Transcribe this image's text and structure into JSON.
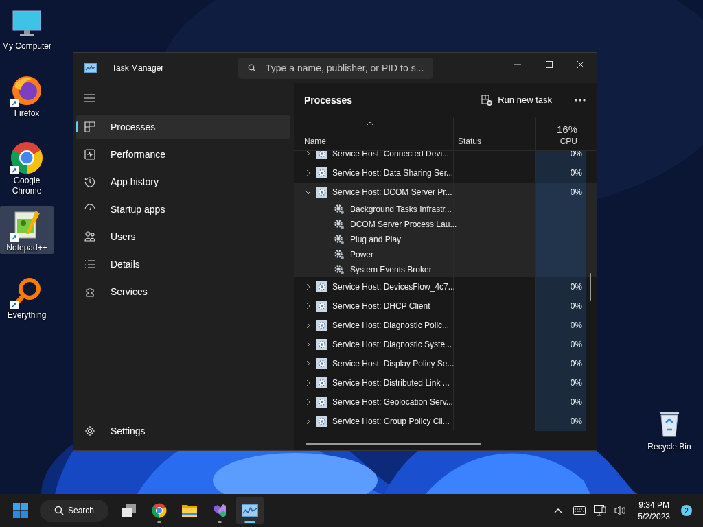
{
  "desktop": {
    "icons": [
      {
        "label": "My Computer",
        "kind": "computer",
        "shortcut": false,
        "selected": false
      },
      {
        "label": "Firefox",
        "kind": "firefox",
        "shortcut": true,
        "selected": false
      },
      {
        "label": "Google Chrome",
        "kind": "chrome",
        "shortcut": true,
        "selected": false
      },
      {
        "label": "Notepad++",
        "kind": "notepad",
        "shortcut": true,
        "selected": true
      },
      {
        "label": "Everything",
        "kind": "everything",
        "shortcut": true,
        "selected": false
      }
    ],
    "recycle_bin": {
      "label": "Recycle Bin"
    }
  },
  "window": {
    "title": "Task Manager",
    "search": {
      "placeholder": "Type a name, publisher, or PID to s..."
    },
    "sidebar": {
      "items": [
        {
          "label": "Processes",
          "kind": "processes",
          "selected": true
        },
        {
          "label": "Performance",
          "kind": "performance",
          "selected": false
        },
        {
          "label": "App history",
          "kind": "history",
          "selected": false
        },
        {
          "label": "Startup apps",
          "kind": "startup",
          "selected": false
        },
        {
          "label": "Users",
          "kind": "users",
          "selected": false
        },
        {
          "label": "Details",
          "kind": "details",
          "selected": false
        },
        {
          "label": "Services",
          "kind": "services",
          "selected": false
        }
      ],
      "settings": "Settings"
    },
    "panel": {
      "title": "Processes",
      "run_new_task": "Run new task",
      "columns": {
        "name": "Name",
        "status": "Status",
        "cpu_total": "16%",
        "cpu": "CPU"
      },
      "rows": [
        {
          "name": "Service Host: Connected Devi...",
          "cpu": "0%",
          "expanded": false,
          "selected": false,
          "children": []
        },
        {
          "name": "Service Host: Data Sharing Ser...",
          "cpu": "0%",
          "expanded": false,
          "selected": false,
          "children": []
        },
        {
          "name": "Service Host: DCOM Server Pr...",
          "cpu": "0%",
          "expanded": true,
          "selected": true,
          "children": [
            {
              "name": "Background Tasks Infrastr..."
            },
            {
              "name": "DCOM Server Process Lau..."
            },
            {
              "name": "Plug and Play"
            },
            {
              "name": "Power"
            },
            {
              "name": "System Events Broker"
            }
          ]
        },
        {
          "name": "Service Host: DevicesFlow_4c7...",
          "cpu": "0%",
          "expanded": false,
          "selected": false,
          "children": []
        },
        {
          "name": "Service Host: DHCP Client",
          "cpu": "0%",
          "expanded": false,
          "selected": false,
          "children": []
        },
        {
          "name": "Service Host: Diagnostic Polic...",
          "cpu": "0%",
          "expanded": false,
          "selected": false,
          "children": []
        },
        {
          "name": "Service Host: Diagnostic Syste...",
          "cpu": "0%",
          "expanded": false,
          "selected": false,
          "children": []
        },
        {
          "name": "Service Host: Display Policy Se...",
          "cpu": "0%",
          "expanded": false,
          "selected": false,
          "children": []
        },
        {
          "name": "Service Host: Distributed Link ...",
          "cpu": "0%",
          "expanded": false,
          "selected": false,
          "children": []
        },
        {
          "name": "Service Host: Geolocation Serv...",
          "cpu": "0%",
          "expanded": false,
          "selected": false,
          "children": []
        },
        {
          "name": "Service Host: Group Policy Cli...",
          "cpu": "0%",
          "expanded": false,
          "selected": false,
          "children": []
        }
      ]
    }
  },
  "taskbar": {
    "search": "Search",
    "apps": [
      {
        "kind": "taskview",
        "running": false,
        "active": false
      },
      {
        "kind": "chrome",
        "running": true,
        "active": false
      },
      {
        "kind": "files",
        "running": false,
        "active": false
      },
      {
        "kind": "studio",
        "running": true,
        "active": false
      },
      {
        "kind": "taskmanager",
        "running": true,
        "active": true
      }
    ],
    "time": "9:34 PM",
    "date": "5/2/2023",
    "notifications": "2"
  }
}
